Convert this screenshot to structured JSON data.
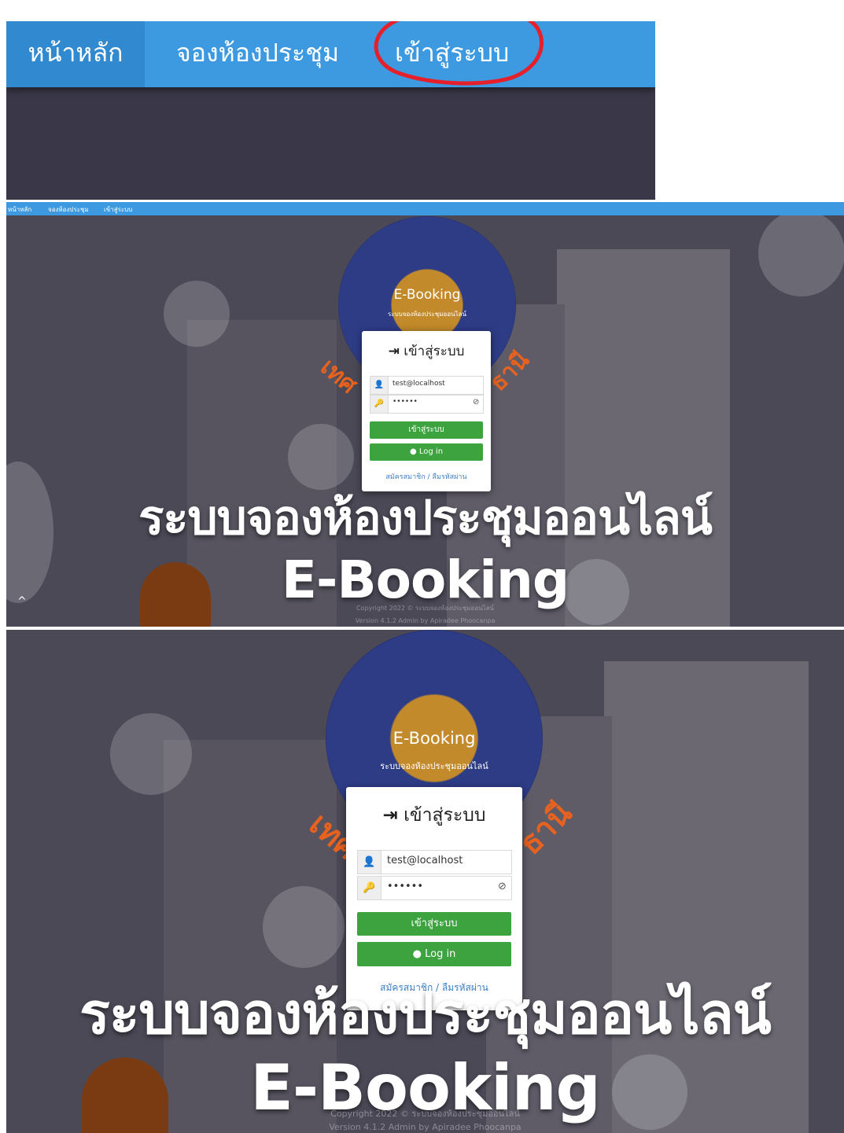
{
  "zoom_nav": {
    "home": "หน้าหลัก",
    "booking": "จองห้องประชุม",
    "login": "เข้าสู่ระบบ"
  },
  "mini_nav": {
    "home": "หน้าหลัก",
    "booking": "จองห้องประชุม",
    "login": "เข้าสู่ระบบ"
  },
  "seal": {
    "title": "E-Booking",
    "subtitle": "ระบบจองห้องประชุมออนไลน์",
    "arc_left": "เทศ",
    "arc_right": "ธานี"
  },
  "login_card": {
    "title": "เข้าสู่ระบบ",
    "username_value": "test@localhost",
    "password_value": "••••••",
    "submit_label": "เข้าสู่ระบบ",
    "line_login_label": "Log in",
    "links": "สมัครสมาชิก / ลืมรหัสผ่าน"
  },
  "headline": {
    "line1": "ระบบจองห้องประชุมออนไลน์",
    "line2": "E-Booking"
  },
  "footer": {
    "copyright": "Copyright 2022 © ระบบจองห้องประชุมออนไลน์",
    "version": "Version 4.1.2 Admin by Apiradee Phoocanpa"
  },
  "colors": {
    "nav_blue": "#3d9ae0",
    "button_green": "#3ca33f",
    "annotation_red": "#e5202a"
  }
}
